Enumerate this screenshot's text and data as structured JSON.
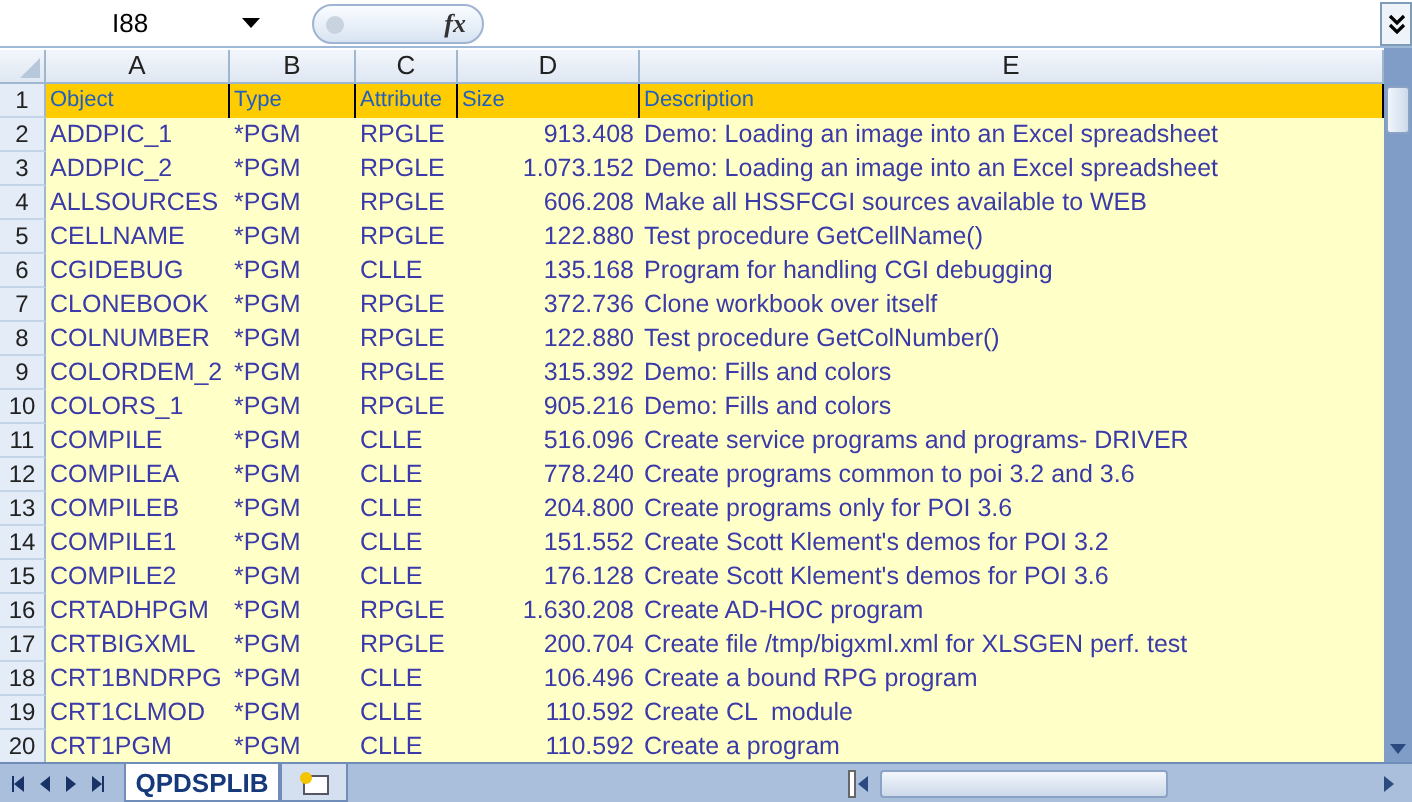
{
  "name_box": "I88",
  "function_label": "fx",
  "columns": [
    "A",
    "B",
    "C",
    "D",
    "E"
  ],
  "rows": [
    {
      "number": "1",
      "kind": "header",
      "cells": [
        "Object",
        "Type",
        "Attribute",
        "Size",
        "Description"
      ]
    },
    {
      "number": "2",
      "kind": "data",
      "cells": [
        "ADDPIC_1",
        "*PGM",
        "RPGLE",
        "913.408",
        "Demo: Loading an image into an Excel spreadsheet"
      ]
    },
    {
      "number": "3",
      "kind": "data",
      "cells": [
        "ADDPIC_2",
        "*PGM",
        "RPGLE",
        "1.073.152",
        "Demo: Loading an image into an Excel spreadsheet"
      ]
    },
    {
      "number": "4",
      "kind": "data",
      "cells": [
        "ALLSOURCES",
        "*PGM",
        "RPGLE",
        "606.208",
        "Make all HSSFCGI sources available to WEB"
      ]
    },
    {
      "number": "5",
      "kind": "data",
      "cells": [
        "CELLNAME",
        "*PGM",
        "RPGLE",
        "122.880",
        "Test procedure GetCellName()"
      ]
    },
    {
      "number": "6",
      "kind": "data",
      "cells": [
        "CGIDEBUG",
        "*PGM",
        "CLLE",
        "135.168",
        "Program for handling CGI debugging"
      ]
    },
    {
      "number": "7",
      "kind": "data",
      "cells": [
        "CLONEBOOK",
        "*PGM",
        "RPGLE",
        "372.736",
        "Clone workbook over itself"
      ]
    },
    {
      "number": "8",
      "kind": "data",
      "cells": [
        "COLNUMBER",
        "*PGM",
        "RPGLE",
        "122.880",
        "Test procedure GetColNumber()"
      ]
    },
    {
      "number": "9",
      "kind": "data",
      "cells": [
        "COLORDEM_2",
        "*PGM",
        "RPGLE",
        "315.392",
        "Demo: Fills and colors"
      ]
    },
    {
      "number": "10",
      "kind": "data",
      "cells": [
        "COLORS_1",
        "*PGM",
        "RPGLE",
        "905.216",
        "Demo: Fills and colors"
      ]
    },
    {
      "number": "11",
      "kind": "data",
      "cells": [
        "COMPILE",
        "*PGM",
        "CLLE",
        "516.096",
        "Create service programs and programs- DRIVER"
      ]
    },
    {
      "number": "12",
      "kind": "data",
      "cells": [
        "COMPILEA",
        "*PGM",
        "CLLE",
        "778.240",
        "Create programs common to poi 3.2 and 3.6"
      ]
    },
    {
      "number": "13",
      "kind": "data",
      "cells": [
        "COMPILEB",
        "*PGM",
        "CLLE",
        "204.800",
        "Create programs only for POI 3.6"
      ]
    },
    {
      "number": "14",
      "kind": "data",
      "cells": [
        "COMPILE1",
        "*PGM",
        "CLLE",
        "151.552",
        "Create Scott Klement's demos for POI 3.2"
      ]
    },
    {
      "number": "15",
      "kind": "data",
      "cells": [
        "COMPILE2",
        "*PGM",
        "CLLE",
        "176.128",
        "Create Scott Klement's demos for POI 3.6"
      ]
    },
    {
      "number": "16",
      "kind": "data",
      "cells": [
        "CRTADHPGM",
        "*PGM",
        "RPGLE",
        "1.630.208",
        "Create AD-HOC program"
      ]
    },
    {
      "number": "17",
      "kind": "data",
      "cells": [
        "CRTBIGXML",
        "*PGM",
        "RPGLE",
        "200.704",
        "Create file /tmp/bigxml.xml for XLSGEN perf. test"
      ]
    },
    {
      "number": "18",
      "kind": "data",
      "cells": [
        "CRT1BNDRPG",
        "*PGM",
        "CLLE",
        "106.496",
        "Create a bound RPG program"
      ]
    },
    {
      "number": "19",
      "kind": "data",
      "cells": [
        "CRT1CLMOD",
        "*PGM",
        "CLLE",
        "110.592",
        "Create CL  module"
      ]
    },
    {
      "number": "20",
      "kind": "data",
      "cells": [
        "CRT1PGM",
        "*PGM",
        "CLLE",
        "110.592",
        "Create a program"
      ]
    }
  ],
  "sheet_tabs": [
    {
      "label": "QPDSPLIB",
      "selected": true
    }
  ]
}
